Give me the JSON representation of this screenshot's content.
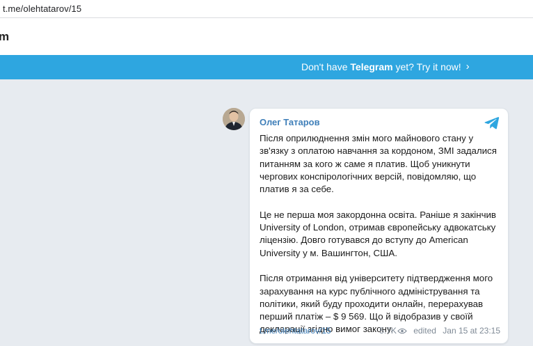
{
  "browser": {
    "url": "t.me/olehtatarov/15"
  },
  "header": {
    "brand_fragment": "m"
  },
  "banner": {
    "prefix": "Don't have ",
    "brand": "Telegram",
    "suffix": " yet? Try it now!",
    "chevron": "›"
  },
  "post": {
    "author": "Олег Татаров",
    "paragraphs": [
      "Після оприлюднення змін мого майнового стану у зв'язку з оплатою навчання за кордоном, ЗМІ задалися питанням за кого ж саме я платив. Щоб уникнути чергових конспірологічних версій, повідомляю, що платив я за себе.",
      "Це не перша моя закордонна освіта. Раніше я закінчив University of London, отримав європейську адвокатську ліцензію. Довго готувався до вступу до American University у м. Вашингтон, США.",
      "Після отримання від університету підтвердження мого зарахування на курс публічного адміністрування та політики, який буду проходити онлайн, перерахував перший платіж – $ 9 569. Що й відобразив у своїй декларації згідно вимог закону."
    ],
    "footer": {
      "link": "t.me/olehtatarov/15",
      "views": "5.7K",
      "edited": "edited",
      "date": "Jan 15 at 23:15"
    }
  },
  "icons": {
    "telegram": "telegram-plane-icon",
    "views": "eye-icon"
  },
  "colors": {
    "banner": "#2ea6e0",
    "link": "#3f7fb9",
    "background": "#e7ebf0"
  }
}
